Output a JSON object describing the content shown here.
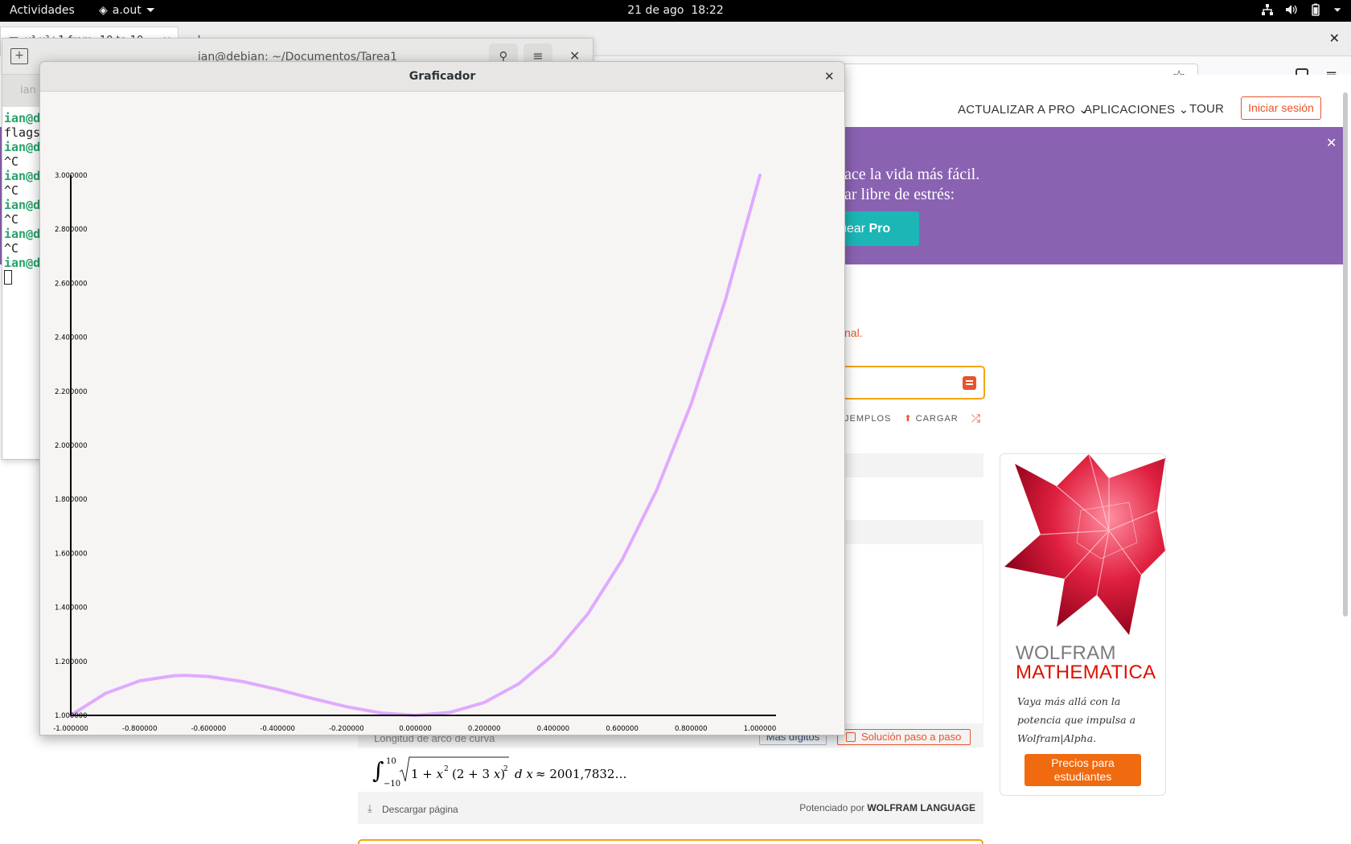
{
  "topbar": {
    "activities": "Actividades",
    "app_name": "a.out",
    "date": "21 de ago",
    "time": "18:22",
    "icons": [
      "network-icon",
      "volume-icon",
      "battery-icon",
      "power-menu-icon"
    ]
  },
  "browser": {
    "tab_title": "x³-x²+1 from -10 to 10",
    "nav": {
      "upgrade": "ACTUALIZAR A PRO",
      "apps": "APLICACIONES",
      "tour": "TOUR",
      "login": "Iniciar sesión"
    },
    "promo": {
      "line1": "ace la vida más fácil.",
      "line2": "ar libre de estrés:",
      "button_prefix": "uear ",
      "button_bold": "Pro"
    },
    "tagline": "nal.",
    "links": {
      "examples": "JEMPLOS",
      "upload": "CARGAR"
    },
    "pod": {
      "title": "Longitud de arco de curva",
      "more_digits": "Más dígitos",
      "step_by_step": "Solución paso a paso",
      "result": "≈ 2001,7832…"
    },
    "footer": {
      "download": "Descargar página",
      "powered_prefix": "Potenciado por ",
      "powered_brand": "WOLFRAM LANGUAGE"
    },
    "ad": {
      "brand1": "WOLFRAM",
      "brand2": "MATHEMATICA",
      "tagline": "Vaya más allá con la potencia que impulsa a Wolfram|Alpha.",
      "cta": "Precios para estudiantes"
    }
  },
  "terminal": {
    "title": "ian@debian: ~/Documentos/Tarea1",
    "subtab": "ian",
    "lines": [
      {
        "prompt": "ian@d",
        "text": ""
      },
      {
        "prompt": "",
        "text": "flags"
      },
      {
        "prompt": "ian@d",
        "text": ""
      },
      {
        "prompt": "",
        "text": "^C"
      },
      {
        "prompt": "ian@d",
        "text": ""
      },
      {
        "prompt": "",
        "text": "^C"
      },
      {
        "prompt": "ian@d",
        "text": ""
      },
      {
        "prompt": "",
        "text": "^C"
      },
      {
        "prompt": "ian@d",
        "text": ""
      },
      {
        "prompt": "",
        "text": "^C"
      },
      {
        "prompt": "ian@d",
        "text": ""
      }
    ]
  },
  "graficador": {
    "title": "Graficador",
    "chart_data": {
      "type": "line",
      "title": "",
      "xlabel": "",
      "ylabel": "",
      "xlim": [
        -1,
        1
      ],
      "ylim": [
        1,
        3
      ],
      "x_ticks": [
        "-1.000000",
        "-0.800000",
        "-0.600000",
        "-0.400000",
        "-0.200000",
        "0.000000",
        "0.200000",
        "0.400000",
        "0.600000",
        "0.800000",
        "1.000000"
      ],
      "y_ticks": [
        "1.000000",
        "1.200000",
        "1.400000",
        "1.600000",
        "1.800000",
        "2.000000",
        "2.200000",
        "2.400000",
        "2.600000",
        "2.800000",
        "3.000000"
      ],
      "series": [
        {
          "color": "#e0aaff",
          "x": [
            -1.0,
            -0.9,
            -0.8,
            -0.7,
            -0.666667,
            -0.6,
            -0.5,
            -0.4,
            -0.3,
            -0.2,
            -0.1,
            0.0,
            0.1,
            0.2,
            0.3,
            0.4,
            0.5,
            0.6,
            0.7,
            0.8,
            0.9,
            1.0
          ],
          "y": [
            1.0,
            1.081,
            1.128,
            1.147,
            1.148,
            1.144,
            1.125,
            1.096,
            1.063,
            1.032,
            1.009,
            1.0,
            1.011,
            1.048,
            1.117,
            1.224,
            1.375,
            1.576,
            1.833,
            2.152,
            2.539,
            3.0
          ]
        }
      ],
      "grid": false,
      "legend": "none"
    }
  }
}
